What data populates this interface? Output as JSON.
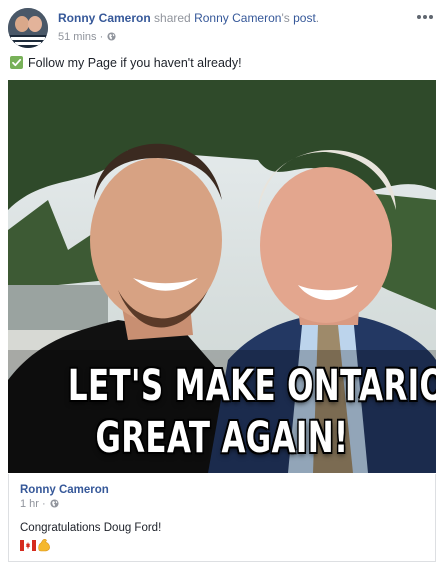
{
  "header": {
    "author": "Ronny Cameron",
    "shared_text": "shared",
    "original_author": "Ronny Cameron",
    "possessive": "'s",
    "post_word": "post",
    "period": ".",
    "time": "51 mins",
    "separator": "·",
    "privacy_icon": "globe-icon",
    "more_icon": "ellipsis-icon"
  },
  "message": {
    "icon": "check-mark-icon",
    "text": "Follow my Page if you haven't already!"
  },
  "photo": {
    "caption_line1": "LET'S MAKE ONTARIO",
    "caption_line2": "GREAT AGAIN!"
  },
  "shared_post": {
    "author": "Ronny Cameron",
    "time": "1 hr",
    "separator": "·",
    "message": "Congratulations Doug Ford!",
    "emojis": [
      "canada-flag-icon",
      "flexed-biceps-icon"
    ]
  },
  "colors": {
    "link": "#365899",
    "muted": "#90949c",
    "text": "#1d2129",
    "check": "#78b159"
  }
}
